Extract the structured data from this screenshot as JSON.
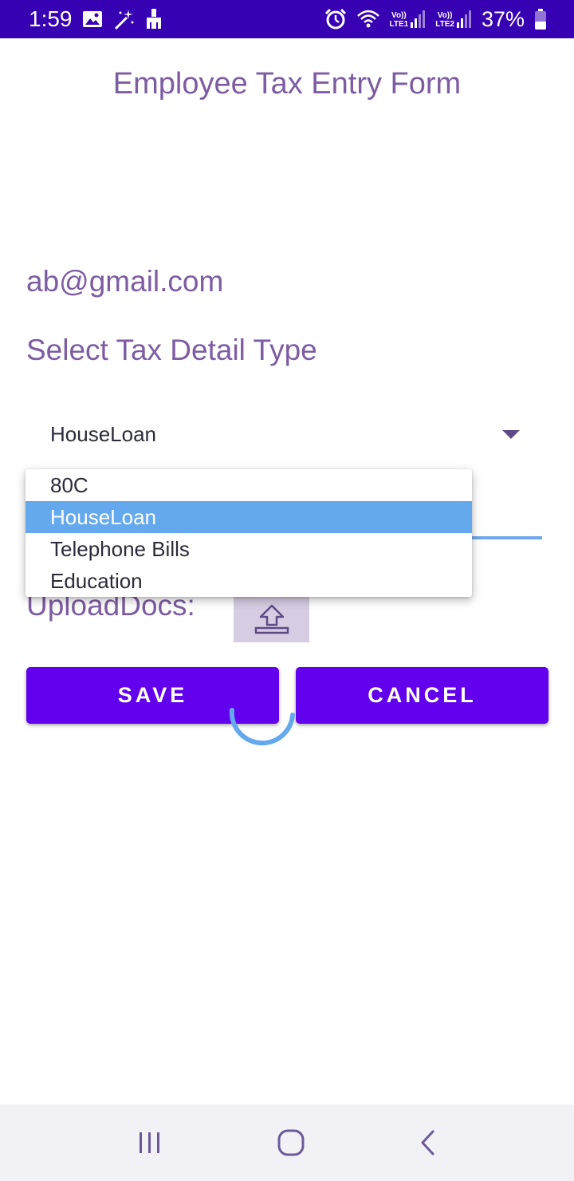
{
  "status_bar": {
    "time": "1:59",
    "battery_percent": "37%",
    "sim1_label_top": "Vo))",
    "sim1_label_bottom": "LTE1",
    "sim2_label_top": "Vo))",
    "sim2_label_bottom": "LTE2",
    "icons": [
      "gallery-icon",
      "magic-wand-icon",
      "broom-icon",
      "alarm-icon",
      "wifi-icon",
      "signal-icon",
      "battery-icon"
    ]
  },
  "page": {
    "title": "Employee Tax Entry Form",
    "email": "ab@gmail.com",
    "tax_type_label": "Select Tax Detail Type",
    "upload_label": "UploadDocs:"
  },
  "spinner": {
    "selected_value": "HouseLoan",
    "options": [
      "80C",
      "HouseLoan",
      "Telephone Bills",
      "Education"
    ],
    "selected_index": 1
  },
  "buttons": {
    "save_label": "SAVE",
    "cancel_label": "CANCEL"
  },
  "colors": {
    "status_bar": "#3700b3",
    "accent_text": "#7d5ca3",
    "primary_button": "#6200ee",
    "selected_item": "#64a8ee",
    "progress": "#64a8ee"
  },
  "nav_bar": {
    "icons": [
      "recent-apps-icon",
      "home-icon",
      "back-icon"
    ]
  }
}
